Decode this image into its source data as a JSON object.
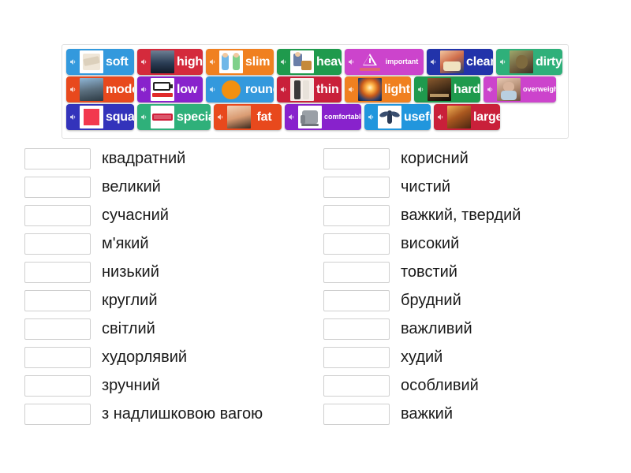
{
  "word_bank": {
    "name": "word-bank",
    "rows": [
      [
        {
          "word": "soft",
          "color": "#3399dd",
          "image": "pillows-photo",
          "icon": "speaker-icon"
        },
        {
          "word": "high",
          "color": "#d42a3c",
          "image": "skyscraper-photo",
          "icon": "speaker-icon"
        },
        {
          "word": "slim",
          "color": "#f08020",
          "image": "slim-people-cartoon",
          "icon": "speaker-icon"
        },
        {
          "word": "heavy",
          "color": "#1f9a4d",
          "image": "heavy-load-cartoon",
          "icon": "speaker-icon"
        },
        {
          "word": "important",
          "color": "#d martin",
          "image": "warning-sign-icon",
          "icon": "speaker-icon"
        },
        {
          "word": "clean",
          "color": "#2233aa",
          "image": "cleaning-photo",
          "icon": "speaker-icon"
        },
        {
          "word": "dirty",
          "color": "#2fb07a",
          "image": "dirty-face-photo",
          "icon": "speaker-icon"
        }
      ],
      [
        {
          "word": "modern",
          "color": "#e8491d",
          "image": "modern-building-photo",
          "icon": "speaker-icon"
        },
        {
          "word": "low",
          "color": "#8822cc",
          "image": "low-battery-icon",
          "icon": "speaker-icon"
        },
        {
          "word": "round",
          "color": "#3399dd",
          "image": "orange-circle",
          "icon": "speaker-icon"
        },
        {
          "word": "thin",
          "color": "#c9203a",
          "image": "thin-person-photo",
          "icon": "speaker-icon"
        },
        {
          "word": "light",
          "color": "#f08020",
          "image": "sunrise-photo",
          "icon": "speaker-icon"
        },
        {
          "word": "hard",
          "color": "#1f9a4d",
          "image": "hard-work-photo",
          "icon": "speaker-icon"
        },
        {
          "word": "overweight",
          "color": "#cc44cc",
          "image": "overweight-person-photo",
          "icon": "speaker-icon"
        }
      ],
      [
        {
          "word": "square",
          "color": "#3333bb",
          "image": "red-square-shape",
          "icon": "speaker-icon"
        },
        {
          "word": "special",
          "color": "#2fb07a",
          "image": "special-label-icon",
          "icon": "speaker-icon"
        },
        {
          "word": "fat",
          "color": "#e8491d",
          "image": "chubby-baby-photo",
          "icon": "speaker-icon"
        },
        {
          "word": "comfortable",
          "color": "#8822cc",
          "image": "armchair-photo",
          "icon": "speaker-icon"
        },
        {
          "word": "useful",
          "color": "#2196dd",
          "image": "insect-photo",
          "icon": "speaker-icon"
        },
        {
          "word": "large",
          "color": "#c9203a",
          "image": "large-room-photo",
          "icon": "speaker-icon"
        }
      ]
    ]
  },
  "answers": {
    "left": [
      {
        "placeholder": "",
        "label": "квадратний"
      },
      {
        "placeholder": "",
        "label": "великий"
      },
      {
        "placeholder": "",
        "label": "сучасний"
      },
      {
        "placeholder": "",
        "label": "м'який"
      },
      {
        "placeholder": "",
        "label": "низький"
      },
      {
        "placeholder": "",
        "label": "круглий"
      },
      {
        "placeholder": "",
        "label": "світлий"
      },
      {
        "placeholder": "",
        "label": "худорлявий"
      },
      {
        "placeholder": "",
        "label": "зручний"
      },
      {
        "placeholder": "",
        "label": "з надлишковою вагою"
      }
    ],
    "right": [
      {
        "placeholder": "",
        "label": "корисний"
      },
      {
        "placeholder": "",
        "label": "чистий"
      },
      {
        "placeholder": "",
        "label": "важкий, твердий"
      },
      {
        "placeholder": "",
        "label": "високий"
      },
      {
        "placeholder": "",
        "label": "товстий"
      },
      {
        "placeholder": "",
        "label": "брудний"
      },
      {
        "placeholder": "",
        "label": "важливий"
      },
      {
        "placeholder": "",
        "label": "худий"
      },
      {
        "placeholder": "",
        "label": "особливий"
      },
      {
        "placeholder": "",
        "label": "важкий"
      }
    ]
  },
  "theme": {
    "page_background": "#ffffff",
    "panel_border": "#e0e0e0",
    "box_border": "#cfcfcf",
    "text_color": "#1a1a1a",
    "tile_text_color": "#ffffff"
  }
}
